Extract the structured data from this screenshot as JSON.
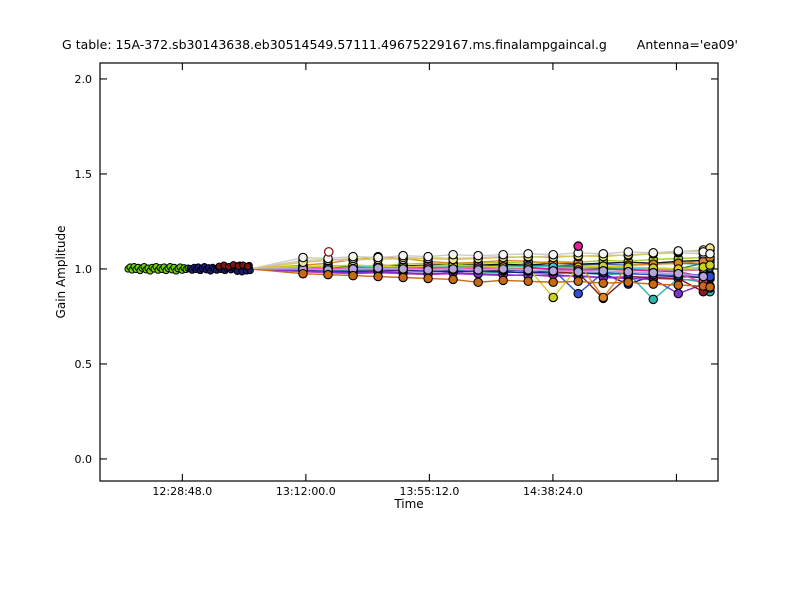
{
  "figure": {
    "title_table": "G table: 15A-372.sb30143638.eb30514549.57111.49675229167.ms.finalampgaincal.g",
    "title_antenna": "Antenna='ea09'",
    "xlabel": "Time",
    "ylabel": "Gain Amplitude"
  },
  "style": {
    "background": "#ffffff",
    "axis_color": "#000000",
    "marker_edge": "#000000"
  },
  "chart_data": {
    "type": "line",
    "title": "G table: 15A-372.sb30143638.eb30514549.57111.49675229167.ms.finalampgaincal.g    Antenna='ea09'",
    "xlabel": "Time",
    "ylabel": "Gain Amplitude",
    "legend": "none",
    "grid": false,
    "x_axis": {
      "unit": "seconds_since_midnight",
      "lim": [
        43200,
        56168
      ],
      "ticks": [
        {
          "seconds": 44928,
          "label": "12:28:48.0"
        },
        {
          "seconds": 47520,
          "label": "13:12:00.0"
        },
        {
          "seconds": 50112,
          "label": "13:55:12.0"
        },
        {
          "seconds": 52704,
          "label": "14:38:24.0"
        },
        {
          "seconds": 55296,
          "label": ""
        }
      ]
    },
    "y_axis": {
      "lim": [
        -0.116,
        2.084
      ],
      "ticks": [
        {
          "value": 0.0,
          "label": "0.0"
        },
        {
          "value": 0.5,
          "label": "0.5"
        },
        {
          "value": 1.0,
          "label": "1.0"
        },
        {
          "value": 1.5,
          "label": "1.5"
        },
        {
          "value": 2.0,
          "label": "2.0"
        }
      ]
    },
    "fan_origin": {
      "t": 46348,
      "v": 1.0
    },
    "cluster_times": [
      47460,
      47985,
      48510,
      49035,
      49560,
      50085,
      50610,
      51135,
      51660,
      52185,
      52710,
      53235,
      53760,
      54285,
      54810,
      55335,
      55860,
      56000
    ],
    "cluster_series": [
      {
        "name": "teal",
        "color": "#2ab5ab",
        "values": [
          1.0,
          0.995,
          1.0,
          0.99,
          0.995,
          0.99,
          0.985,
          0.99,
          0.985,
          0.98,
          0.975,
          0.98,
          0.97,
          0.975,
          0.84,
          0.95,
          0.93,
          0.88
        ]
      },
      {
        "name": "magenta",
        "color": "#d4219c",
        "values": [
          1.005,
          1.0,
          1.01,
          1.005,
          1.0,
          1.005,
          1.01,
          1.005,
          1.0,
          1.005,
          1.0,
          0.995,
          1.0,
          0.995,
          0.99,
          0.985,
          0.96,
          0.95
        ]
      },
      {
        "name": "navy",
        "color": "#1c1c8a",
        "values": [
          0.995,
          0.99,
          0.985,
          0.99,
          0.995,
          0.99,
          0.985,
          0.99,
          0.985,
          0.98,
          0.985,
          0.98,
          0.975,
          0.92,
          0.965,
          0.96,
          0.955,
          0.95
        ]
      },
      {
        "name": "black",
        "color": "#141414",
        "values": [
          1.01,
          1.015,
          1.01,
          1.02,
          1.015,
          1.02,
          1.025,
          1.02,
          1.025,
          1.02,
          1.03,
          1.025,
          1.03,
          1.035,
          1.03,
          1.04,
          1.045,
          1.05
        ]
      },
      {
        "name": "green",
        "color": "#2e8b2e",
        "values": [
          1.0,
          1.005,
          1.0,
          1.01,
          1.005,
          1.01,
          1.015,
          1.01,
          1.005,
          1.01,
          1.015,
          1.01,
          1.005,
          1.0,
          1.005,
          1.0,
          1.03,
          1.04
        ]
      },
      {
        "name": "purple",
        "color": "#7b2fd4",
        "values": [
          0.99,
          0.985,
          0.98,
          0.985,
          0.98,
          0.975,
          0.98,
          0.975,
          0.97,
          0.965,
          0.97,
          0.96,
          0.955,
          0.95,
          0.945,
          0.87,
          0.92,
          0.91
        ]
      },
      {
        "name": "darkred",
        "color": "#8b1a1a",
        "values": [
          1.0,
          0.995,
          1.005,
          1.0,
          0.995,
          1.0,
          0.995,
          1.0,
          0.99,
          0.995,
          0.985,
          0.98,
          0.845,
          0.96,
          0.955,
          0.95,
          0.88,
          0.97
        ]
      },
      {
        "name": "royalblue",
        "color": "#2f4fd0",
        "values": [
          1.0,
          1.005,
          0.995,
          1.0,
          1.005,
          1.0,
          0.995,
          1.0,
          0.995,
          0.99,
          0.995,
          0.87,
          0.98,
          0.975,
          0.97,
          0.965,
          0.97,
          0.96
        ]
      },
      {
        "name": "olive",
        "color": "#a8cc2a",
        "values": [
          1.01,
          1.015,
          1.02,
          1.015,
          1.025,
          1.03,
          1.025,
          1.03,
          1.035,
          1.03,
          1.04,
          1.035,
          1.045,
          1.04,
          1.05,
          1.055,
          1.06,
          1.08
        ]
      },
      {
        "name": "orange",
        "color": "#e0861e",
        "values": [
          1.02,
          1.03,
          1.05,
          1.065,
          1.055,
          1.04,
          1.03,
          1.035,
          1.045,
          1.04,
          1.03,
          1.035,
          0.85,
          1.02,
          1.025,
          1.03,
          1.04,
          1.06
        ]
      },
      {
        "name": "cyan",
        "color": "#3cc8dc",
        "values": [
          1.005,
          1.0,
          1.01,
          1.015,
          1.01,
          1.015,
          1.01,
          1.005,
          1.01,
          1.015,
          1.01,
          1.005,
          1.01,
          1.005,
          1.0,
          0.995,
          1.0,
          1.01
        ]
      },
      {
        "name": "yellow",
        "color": "#cfd022",
        "values": [
          1.015,
          1.01,
          1.02,
          1.015,
          1.01,
          1.015,
          1.02,
          1.015,
          1.01,
          1.005,
          0.85,
          1.01,
          1.015,
          1.01,
          1.005,
          1.0,
          1.01,
          1.02
        ]
      },
      {
        "name": "hotpink",
        "color": "#f04fb0",
        "values": [
          1.0,
          1.005,
          1.0,
          0.995,
          1.0,
          1.005,
          1.0,
          1.005,
          1.0,
          0.995,
          0.99,
          0.995,
          0.99,
          0.985,
          0.98,
          0.975,
          0.93,
          0.9
        ]
      },
      {
        "name": "lavender",
        "color": "#b4a6dc",
        "values": [
          1.0,
          0.995,
          1.0,
          1.005,
          1.0,
          0.995,
          1.0,
          0.995,
          1.0,
          0.995,
          0.99,
          0.985,
          0.99,
          0.985,
          0.98,
          0.975,
          0.96,
          0.905
        ]
      },
      {
        "name": "darkorange",
        "color": "#c96a12",
        "values": [
          0.975,
          0.97,
          0.965,
          0.96,
          0.955,
          0.95,
          0.945,
          0.93,
          0.94,
          0.935,
          0.93,
          0.935,
          0.925,
          0.93,
          0.92,
          0.915,
          0.91,
          0.905
        ]
      },
      {
        "name": "white-open",
        "color": "#ffffff",
        "open": true,
        "line_color": "#c8c8c8",
        "values": [
          1.045,
          1.05,
          1.045,
          1.055,
          1.05,
          1.06,
          1.055,
          1.06,
          1.065,
          1.06,
          1.07,
          1.065,
          1.075,
          1.07,
          1.08,
          1.085,
          1.08,
          1.1
        ]
      },
      {
        "name": "khaki-open",
        "color": "#f0e68c",
        "open": true,
        "line_color": "#d8c850",
        "values": [
          1.035,
          1.045,
          1.055,
          1.05,
          1.06,
          1.055,
          1.05,
          1.055,
          1.06,
          1.065,
          1.06,
          1.07,
          1.065,
          1.075,
          1.08,
          1.09,
          1.1,
          1.11
        ]
      },
      {
        "name": "white2-open",
        "color": "#f5f5f5",
        "open": true,
        "line_color": "#cccccc",
        "values": [
          1.06,
          1.055,
          1.065,
          1.06,
          1.07,
          1.065,
          1.075,
          1.07,
          1.075,
          1.08,
          1.075,
          1.085,
          1.08,
          1.09,
          1.085,
          1.095,
          1.09,
          1.08
        ]
      }
    ],
    "filler_series": [
      {
        "name": "seagreen-line",
        "color": "#2e9e86",
        "markers": false,
        "values": [
          0.995,
          0.99,
          0.995,
          0.985,
          0.99,
          0.985,
          0.99,
          0.985,
          0.98,
          0.985,
          0.98,
          0.975,
          0.98,
          0.975,
          0.97,
          0.965,
          0.96,
          0.955
        ]
      },
      {
        "name": "violet-line",
        "color": "#bf40bf",
        "markers": false,
        "values": [
          0.985,
          0.98,
          0.975,
          0.98,
          0.975,
          0.97,
          0.975,
          0.97,
          0.965,
          0.97,
          0.96,
          0.965,
          0.955,
          0.96,
          0.95,
          0.945,
          0.94,
          0.935
        ]
      },
      {
        "name": "steel-line",
        "color": "#4868b8",
        "markers": false,
        "values": [
          1.005,
          1.01,
          1.005,
          1.015,
          1.01,
          1.015,
          1.01,
          1.02,
          1.015,
          1.02,
          1.015,
          1.02,
          1.025,
          1.02,
          1.025,
          1.03,
          1.025,
          1.035
        ]
      },
      {
        "name": "salmon-line",
        "color": "#e07070",
        "markers": false,
        "values": [
          1.0,
          0.995,
          1.005,
          1.0,
          1.01,
          1.005,
          1.0,
          1.005,
          1.01,
          1.005,
          1.0,
          1.005,
          1.0,
          0.995,
          1.0,
          0.99,
          0.995,
          1.0
        ]
      }
    ],
    "dense_segments": [
      {
        "name": "scan1-green",
        "color": "#6fd400",
        "t0": 43790,
        "dt": 42,
        "values": [
          1.0,
          1.01,
          0.995,
          1.012,
          0.998,
          1.008,
          0.992,
          1.005,
          1.012,
          0.996,
          1.004,
          0.99,
          1.008,
          1.0,
          1.012,
          0.994,
          1.006,
          0.998,
          1.01,
          0.992,
          1.004,
          1.012,
          0.996,
          1.008,
          0.99,
          1.002,
          1.01,
          0.994,
          1.006,
          0.998,
          1.004
        ]
      },
      {
        "name": "scan2-navy",
        "color": "#1a1a70",
        "t0": 45090,
        "dt": 43,
        "values": [
          1.002,
          0.994,
          1.008,
          0.998,
          1.01,
          0.992,
          1.004,
          1.012,
          0.996,
          1.006,
          0.99,
          1.008,
          1.0,
          0.994,
          1.01,
          0.998,
          1.006,
          0.992,
          1.004,
          1.01,
          0.996,
          1.008,
          1.0,
          1.012,
          0.994,
          1.004,
          0.998,
          1.008,
          0.996,
          1.002
        ]
      },
      {
        "name": "scan2-navy-blob",
        "color": "#1a1a70",
        "points": [
          [
            46030,
            1.018
          ],
          [
            46080,
            0.988
          ],
          [
            46130,
            1.02
          ],
          [
            46180,
            0.985
          ],
          [
            46230,
            1.015
          ],
          [
            46280,
            0.99
          ],
          [
            46330,
            1.018
          ],
          [
            46350,
            0.992
          ]
        ]
      },
      {
        "name": "scan2-darkred",
        "color": "#7a1616",
        "points": [
          [
            45700,
            1.014
          ],
          [
            45800,
            1.02
          ],
          [
            45900,
            1.012
          ],
          [
            46000,
            1.022
          ],
          [
            46100,
            1.015
          ],
          [
            46200,
            1.02
          ],
          [
            46300,
            1.013
          ]
        ]
      }
    ],
    "outliers": [
      {
        "t": 48000,
        "v": 1.09,
        "color": "#8b1a1a",
        "open": true
      },
      {
        "t": 53235,
        "v": 1.12,
        "color": "#e0219c",
        "open": false
      }
    ]
  }
}
